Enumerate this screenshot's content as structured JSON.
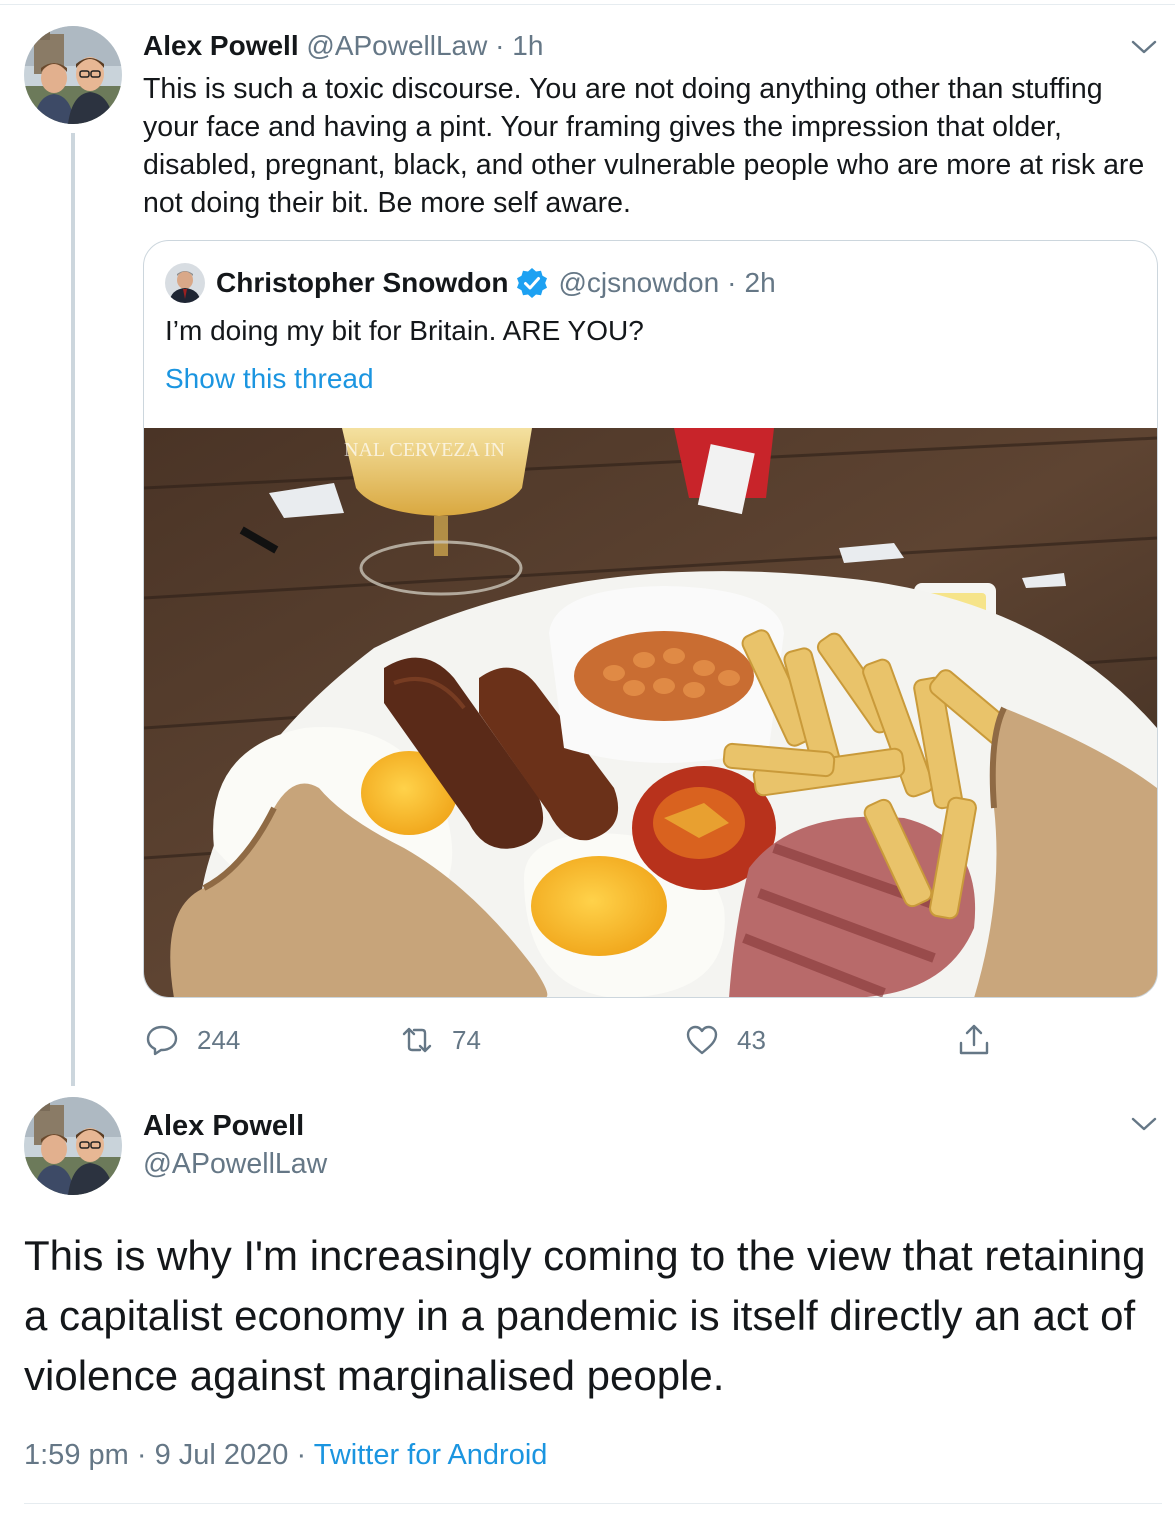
{
  "reply_tweet": {
    "author_name": "Alex Powell",
    "author_handle": "@APowellLaw",
    "separator": "·",
    "time": "1h",
    "text": "This is such a toxic discourse. You are not doing anything other than stuffing your face and having a pint. Your framing gives the impression that older, disabled, pregnant, black, and other vulnerable people who are more at risk are not doing their bit. Be more self aware.",
    "avatar_icon": "profile-photo-two-men",
    "menu_icon": "chevron-down-icon"
  },
  "quoted_tweet": {
    "author_name": "Christopher Snowdon",
    "verified_icon": "verified-badge-icon",
    "author_handle": "@cjsnowdon",
    "separator": "·",
    "time": "2h",
    "text": "I’m doing my bit for Britain. ARE YOU?",
    "show_thread_label": "Show this thread",
    "image_description_icon": "full-english-breakfast-photo",
    "glass_text": "NAL CERVEZA IN"
  },
  "actions": {
    "reply_count": "244",
    "retweet_count": "74",
    "like_count": "43",
    "icons": [
      "reply-icon",
      "retweet-icon",
      "like-icon",
      "share-icon"
    ]
  },
  "main_tweet": {
    "author_name": "Alex Powell",
    "author_handle": "@APowellLaw",
    "text": "This is why I'm increasingly coming to the view that retaining a capitalist economy in a pandemic is itself directly an act of violence against marginalised people.",
    "time": "1:59 pm",
    "separator": "·",
    "date": "9 Jul 2020",
    "source": "Twitter for Android"
  },
  "colors": {
    "link_blue": "#1b95e0",
    "secondary_text": "#657786",
    "border": "#ccd6dd",
    "verified_blue": "#1da1f2"
  }
}
